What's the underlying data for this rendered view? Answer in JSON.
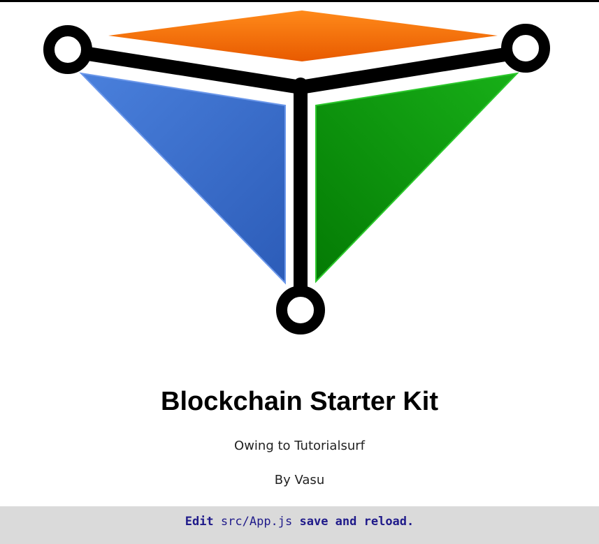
{
  "app": {
    "title": "Blockchain Starter Kit",
    "subtitle_line1": "Owing to Tutorialsurf",
    "subtitle_line2": "By Vasu"
  },
  "footer": {
    "prefix": "Edit ",
    "code": "src/App.js",
    "suffix": " save and reload."
  },
  "logo": {
    "icon": "blockchain-logo-icon",
    "colors": {
      "top": "#f06a0a",
      "left": "#3a6fcf",
      "right": "#0a9a0a",
      "frame": "#000000"
    }
  },
  "colors": {
    "footer_bg": "#dadada",
    "footer_text": "#1f1a8a"
  }
}
